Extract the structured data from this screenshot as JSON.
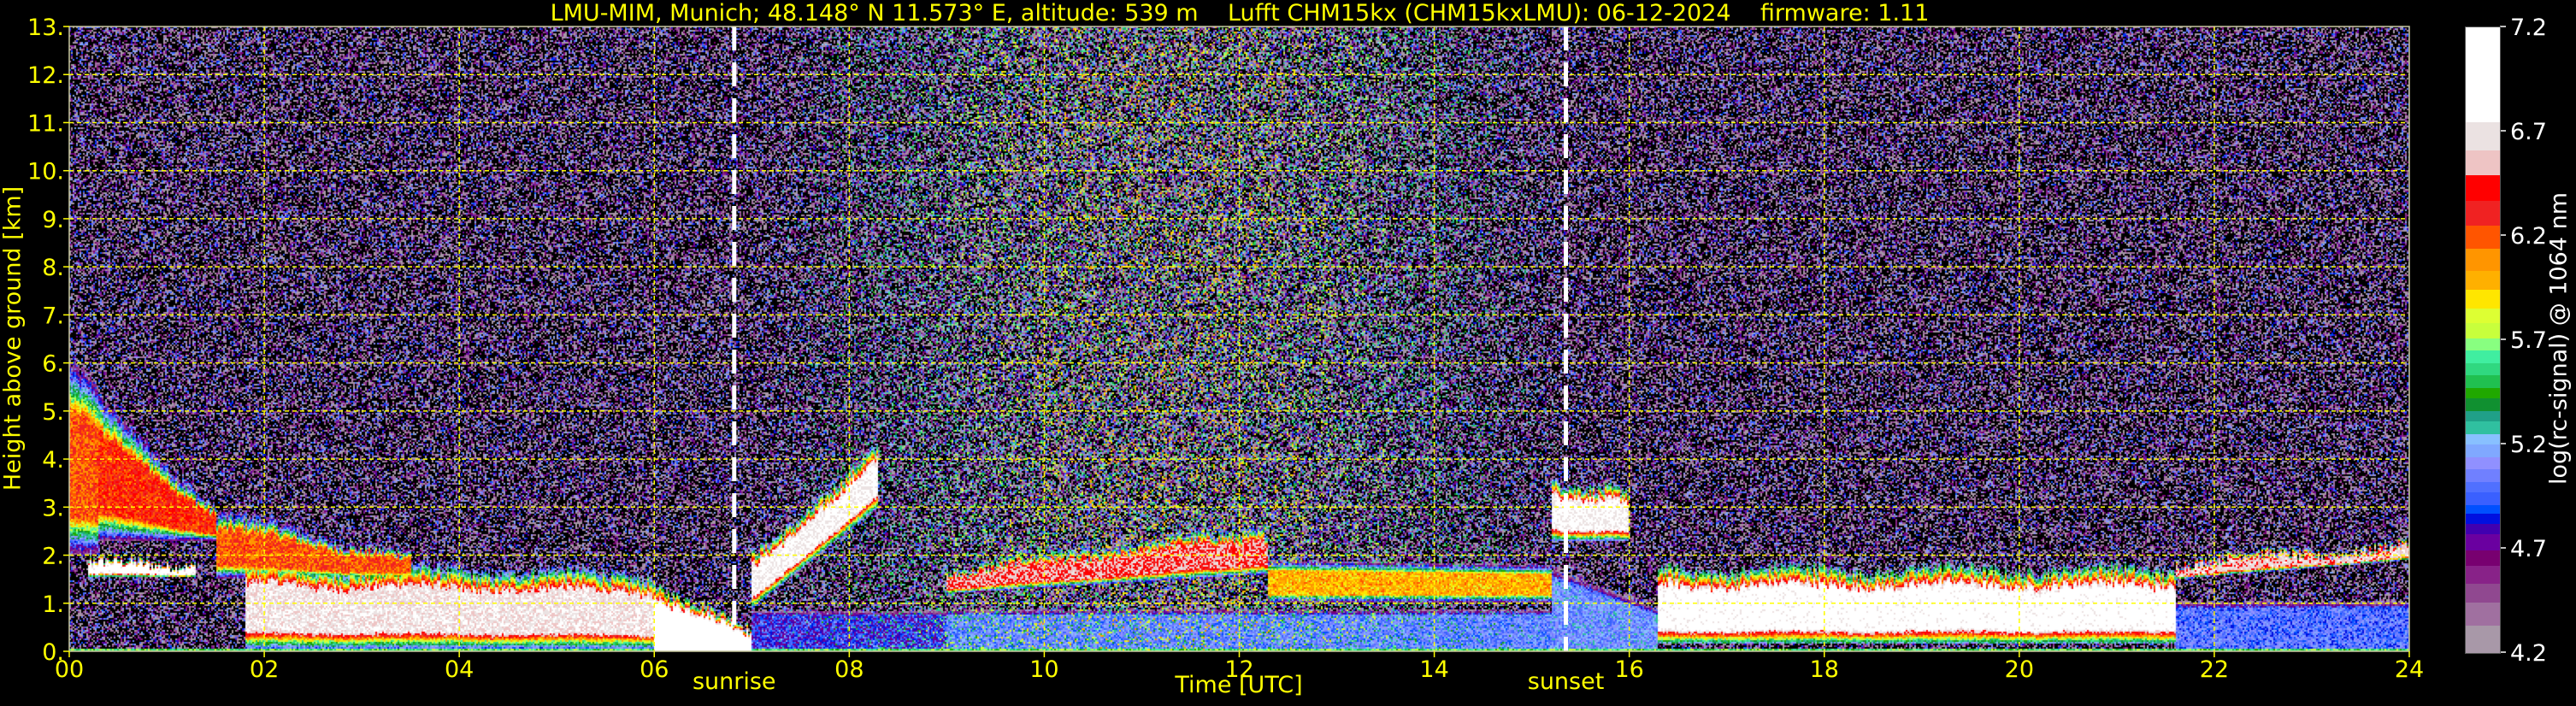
{
  "title": "LMU-MIM, Munich; 48.148° N 11.573° E, altitude: 539 m    Lufft CHM15kx (CHM15kxLMU): 06-12-2024    firmware: 1.11",
  "chart_data": {
    "type": "heatmap",
    "title": "LMU-MIM, Munich; 48.148° N 11.573° E, altitude: 539 m    Lufft CHM15kx (CHM15kxLMU): 06-12-2024    firmware: 1.11",
    "xlabel": "Time [UTC]",
    "ylabel": "Height above ground [km]",
    "xlim": [
      0,
      24
    ],
    "ylim": [
      0,
      13
    ],
    "grid": true,
    "x_ticks": [
      0,
      2,
      4,
      6,
      8,
      10,
      12,
      14,
      16,
      18,
      20,
      22,
      24
    ],
    "x_tick_labels": [
      "00",
      "02",
      "04",
      "06",
      "08",
      "10",
      "12",
      "14",
      "16",
      "18",
      "20",
      "22",
      "24"
    ],
    "y_ticks": [
      0,
      1,
      2,
      3,
      4,
      5,
      6,
      7,
      8,
      9,
      10,
      11,
      12,
      13
    ],
    "y_tick_labels": [
      "0.",
      "1.",
      "2.",
      "3.",
      "4.",
      "5.",
      "6.",
      "7.",
      "8.",
      "9.",
      "10.",
      "11.",
      "12.",
      "13."
    ],
    "annotations": [
      {
        "label": "sunrise",
        "time": 6.82
      },
      {
        "label": "sunset",
        "time": 15.35
      }
    ],
    "colorbar": {
      "label": "log(rc-signal) @ 1064 nm",
      "range": [
        4.2,
        7.2
      ],
      "ticks": [
        7.2,
        6.7,
        6.2,
        5.7,
        5.2,
        4.7,
        4.2
      ],
      "tick_labels": [
        "7.2",
        "6.7",
        "6.2",
        "5.7",
        "5.2",
        "4.7",
        "4.2"
      ],
      "bins": [
        {
          "from": 6.745,
          "to": 7.2,
          "color": "#ffffff"
        },
        {
          "from": 6.61,
          "to": 6.745,
          "color": "#ebe2e2"
        },
        {
          "from": 6.49,
          "to": 6.61,
          "color": "#eec4c4"
        },
        {
          "from": 6.37,
          "to": 6.49,
          "color": "#ff0000"
        },
        {
          "from": 6.25,
          "to": 6.37,
          "color": "#f02222"
        },
        {
          "from": 6.14,
          "to": 6.25,
          "color": "#ff5500"
        },
        {
          "from": 6.03,
          "to": 6.14,
          "color": "#ff9500"
        },
        {
          "from": 5.94,
          "to": 6.03,
          "color": "#ffb000"
        },
        {
          "from": 5.85,
          "to": 5.94,
          "color": "#ffe600"
        },
        {
          "from": 5.78,
          "to": 5.85,
          "color": "#ddff33"
        },
        {
          "from": 5.71,
          "to": 5.78,
          "color": "#c8ff3c"
        },
        {
          "from": 5.65,
          "to": 5.71,
          "color": "#88ff80"
        },
        {
          "from": 5.59,
          "to": 5.65,
          "color": "#40eea0"
        },
        {
          "from": 5.53,
          "to": 5.59,
          "color": "#30d880"
        },
        {
          "from": 5.47,
          "to": 5.53,
          "color": "#20c050"
        },
        {
          "from": 5.42,
          "to": 5.47,
          "color": "#20a800"
        },
        {
          "from": 5.36,
          "to": 5.42,
          "color": "#109030"
        },
        {
          "from": 5.31,
          "to": 5.36,
          "color": "#20a088"
        },
        {
          "from": 5.25,
          "to": 5.31,
          "color": "#30c0a0"
        },
        {
          "from": 5.2,
          "to": 5.25,
          "color": "#88c0ff"
        },
        {
          "from": 5.14,
          "to": 5.2,
          "color": "#80a8ff"
        },
        {
          "from": 5.08,
          "to": 5.14,
          "color": "#9090ff"
        },
        {
          "from": 5.02,
          "to": 5.08,
          "color": "#7080ff"
        },
        {
          "from": 4.97,
          "to": 5.02,
          "color": "#5070ff"
        },
        {
          "from": 4.91,
          "to": 4.97,
          "color": "#3a60ff"
        },
        {
          "from": 4.87,
          "to": 4.91,
          "color": "#0050ff"
        },
        {
          "from": 4.82,
          "to": 4.87,
          "color": "#0010e0"
        },
        {
          "from": 4.77,
          "to": 4.82,
          "color": "#4000b0"
        },
        {
          "from": 4.69,
          "to": 4.77,
          "color": "#6a00a0"
        },
        {
          "from": 4.62,
          "to": 4.69,
          "color": "#780070"
        },
        {
          "from": 4.53,
          "to": 4.62,
          "color": "#882288"
        },
        {
          "from": 4.44,
          "to": 4.53,
          "color": "#904890"
        },
        {
          "from": 4.33,
          "to": 4.44,
          "color": "#a070a0"
        },
        {
          "from": 4.2,
          "to": 4.33,
          "color": "#a898a8"
        }
      ]
    },
    "layers": [
      {
        "t": [
          0,
          0.3
        ],
        "base_km": [
          2.0,
          2.0
        ],
        "top_km": [
          6.0,
          5.5
        ],
        "peak": 6.2
      },
      {
        "t": [
          0.3,
          1.5
        ],
        "base_km": [
          2.3,
          2.3
        ],
        "top_km": [
          5.2,
          3.0
        ],
        "peak": 6.3
      },
      {
        "t": [
          0.2,
          1.3
        ],
        "base_km": [
          1.55,
          1.55
        ],
        "top_km": [
          1.85,
          1.85
        ],
        "peak": 6.9
      },
      {
        "t": [
          1.5,
          3.5
        ],
        "base_km": [
          1.5,
          1.5
        ],
        "top_km": [
          2.9,
          2.0
        ],
        "peak": 6.2
      },
      {
        "t": [
          1.8,
          6.0
        ],
        "base_km": [
          0.05,
          0.05
        ],
        "top_km": [
          1.8,
          1.6
        ],
        "peak": 6.7
      },
      {
        "t": [
          6.0,
          7.0
        ],
        "base_km": [
          0.0,
          0.0
        ],
        "top_km": [
          1.4,
          0.4
        ],
        "peak": 7.0
      },
      {
        "t": [
          7.0,
          8.3
        ],
        "base_km": [
          0.9,
          3.0
        ],
        "top_km": [
          2.0,
          4.2
        ],
        "peak": 6.8
      },
      {
        "t": [
          7.0,
          9.0
        ],
        "base_km": [
          0.0,
          0.0
        ],
        "top_km": [
          1.0,
          1.0
        ],
        "peak": 4.85
      },
      {
        "t": [
          9.0,
          15.2
        ],
        "base_km": [
          0.0,
          0.0
        ],
        "top_km": [
          1.0,
          1.0
        ],
        "peak": 5.05
      },
      {
        "t": [
          9.0,
          12.3
        ],
        "base_km": [
          1.2,
          1.6
        ],
        "top_km": [
          1.7,
          2.6
        ],
        "peak": 6.5
      },
      {
        "t": [
          12.3,
          15.2
        ],
        "base_km": [
          1.0,
          1.0
        ],
        "top_km": [
          1.9,
          1.8
        ],
        "peak": 6.0
      },
      {
        "t": [
          15.2,
          16.0
        ],
        "base_km": [
          2.3,
          2.3
        ],
        "top_km": [
          3.6,
          3.3
        ],
        "peak": 6.8
      },
      {
        "t": [
          15.2,
          16.3
        ],
        "base_km": [
          0.0,
          0.0
        ],
        "top_km": [
          2.0,
          1.0
        ],
        "peak": 5.1
      },
      {
        "t": [
          16.3,
          21.6
        ],
        "base_km": [
          0.15,
          0.15
        ],
        "top_km": [
          1.7,
          1.7
        ],
        "peak": 6.9
      },
      {
        "t": [
          21.6,
          24
        ],
        "base_km": [
          0.0,
          0.0
        ],
        "top_km": [
          1.2,
          1.2
        ],
        "peak": 5.0
      },
      {
        "t": [
          21.6,
          24
        ],
        "base_km": [
          1.5,
          1.9
        ],
        "top_km": [
          1.9,
          2.2
        ],
        "peak": 6.6
      },
      {
        "t": [
          0,
          24
        ],
        "base_km": [
          0.0,
          0.0
        ],
        "top_km": [
          0.07,
          0.07
        ],
        "peak": 5.6
      }
    ]
  }
}
